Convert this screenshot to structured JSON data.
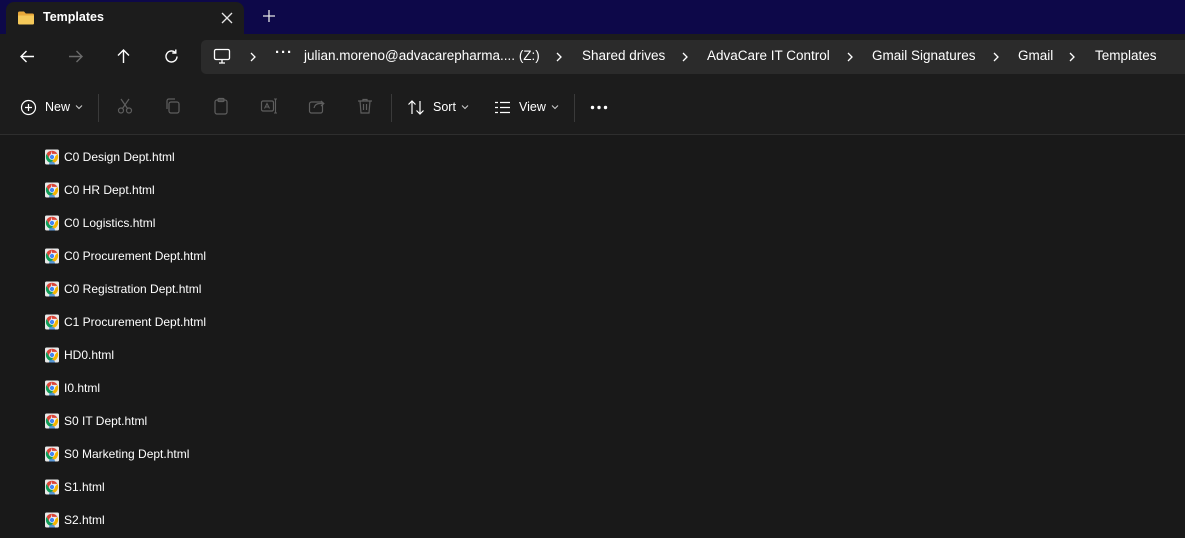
{
  "tab": {
    "title": "Templates",
    "new_tab_symbol": "+"
  },
  "address": {
    "ellipsis": "···",
    "breadcrumbs": [
      "julian.moreno@advacarepharma.... (Z:)",
      "Shared drives",
      "AdvaCare IT Control",
      "Gmail Signatures",
      "Gmail",
      "Templates"
    ]
  },
  "toolbar": {
    "new_label": "New",
    "sort_label": "Sort",
    "view_label": "View"
  },
  "files": [
    "C0 Design Dept.html",
    "C0 HR Dept.html",
    "C0 Logistics.html",
    "C0 Procurement Dept.html",
    "C0 Registration Dept.html",
    "C1 Procurement Dept.html",
    "HD0.html",
    "I0.html",
    "S0 IT Dept.html",
    "S0 Marketing Dept.html",
    "S1.html",
    "S2.html"
  ],
  "colors": {
    "tabstrip": "#0d0849",
    "chrome_bar": "#1c1c1c",
    "content": "#191919",
    "folder": "#f2c14e"
  }
}
